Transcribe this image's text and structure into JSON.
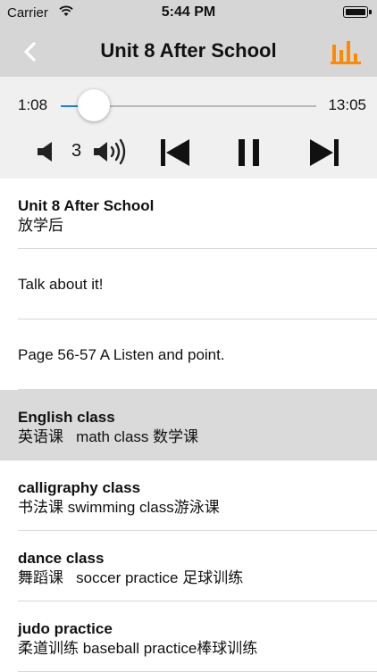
{
  "status_bar": {
    "carrier": "Carrier",
    "time": "5:44 PM"
  },
  "nav": {
    "title": "Unit 8 After School",
    "accent_color": "#ff8a00"
  },
  "player": {
    "elapsed": "1:08",
    "duration": "13:05",
    "progress_fraction": 0.13,
    "volume": "3"
  },
  "lessons": [
    {
      "title": "Unit 8 After School",
      "subtitle": "放学后"
    },
    {
      "title": "",
      "subtitle": "Talk about it!"
    },
    {
      "title": "",
      "subtitle": "Page 56-57 A Listen and point."
    },
    {
      "title": "English class",
      "subtitle": "英语课   math class 数学课"
    },
    {
      "title": "calligraphy class",
      "subtitle": "书法课 swimming class游泳课"
    },
    {
      "title": "dance class",
      "subtitle": "舞蹈课   soccer practice 足球训练"
    },
    {
      "title": "judo practice",
      "subtitle": "柔道训练 baseball practice棒球训练"
    }
  ],
  "selected_index": 3
}
